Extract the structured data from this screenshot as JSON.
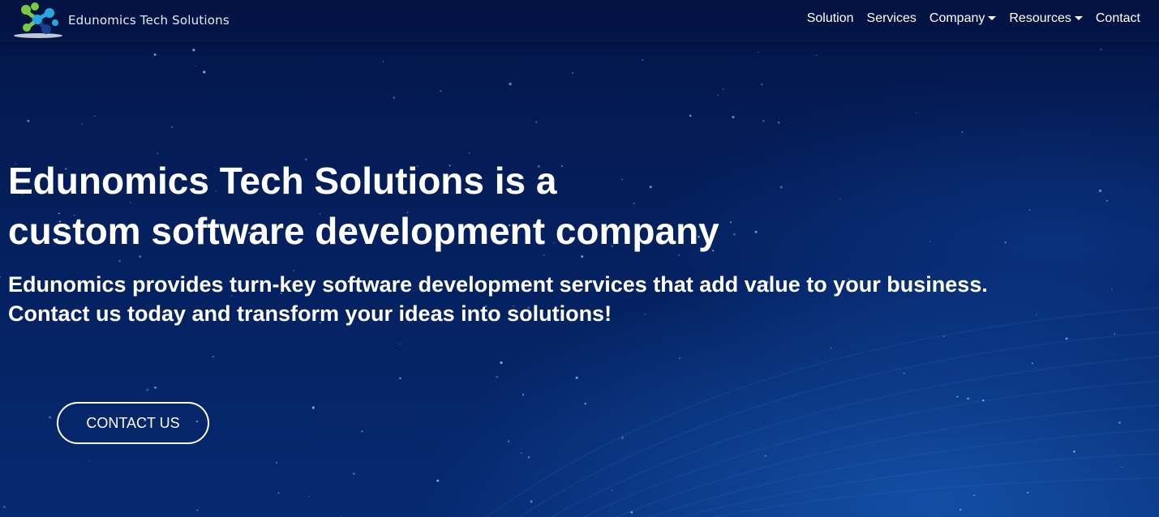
{
  "brand": {
    "name": "Edunomics Tech Solutions",
    "logo_icon": "molecule-logo-icon"
  },
  "nav": {
    "items": [
      {
        "label": "Solution",
        "dropdown": false
      },
      {
        "label": "Services",
        "dropdown": false
      },
      {
        "label": "Company",
        "dropdown": true
      },
      {
        "label": "Resources",
        "dropdown": true
      },
      {
        "label": "Contact",
        "dropdown": false
      }
    ]
  },
  "hero": {
    "title_line1": "Edunomics Tech Solutions is a",
    "title_line2": "custom software development company",
    "subtitle_line1": "Edunomics provides turn-key software development services that add value to your business.",
    "subtitle_line2": "Contact us today and transform your ideas into solutions!",
    "cta_label": "CONTACT US"
  },
  "colors": {
    "background": "#041a52",
    "text": "#ffffff",
    "logo_green": "#7ac943",
    "logo_blue": "#29a8e0",
    "logo_navy": "#1b3f8f"
  }
}
